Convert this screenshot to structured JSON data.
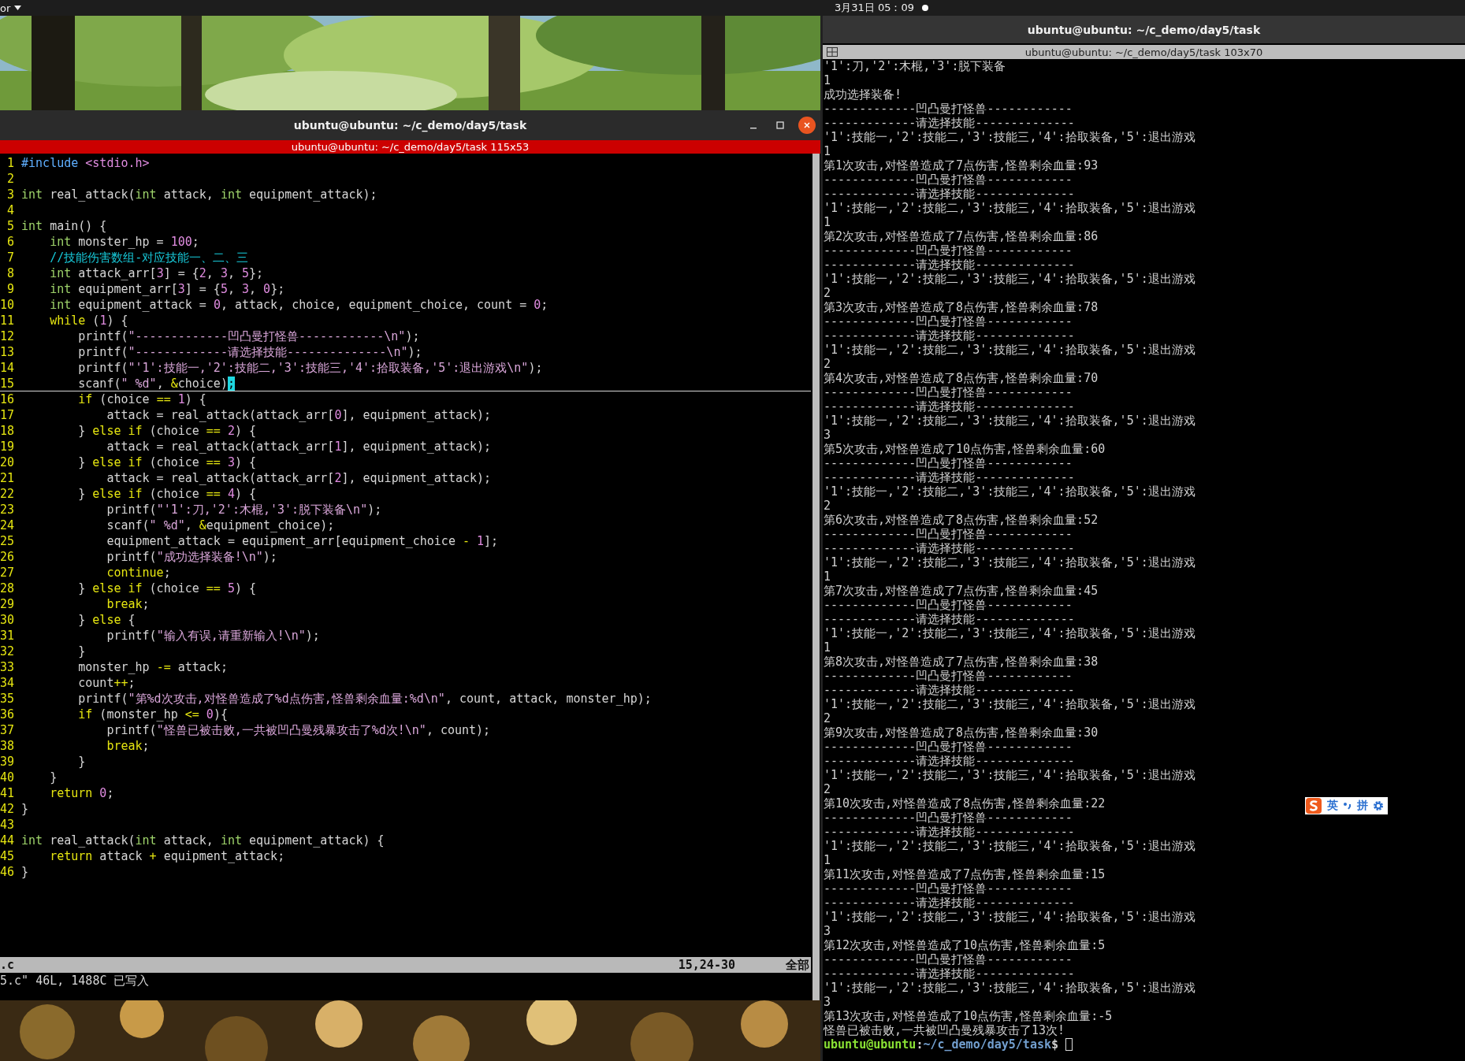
{
  "top_bar": {
    "app_menu": "or",
    "clock": "3月31日 05：09"
  },
  "editor_window": {
    "title": "ubuntu@ubuntu: ~/c_demo/day5/task",
    "tab_title": "ubuntu@ubuntu: ~/c_demo/day5/task 115x53",
    "focused": true,
    "lines": [
      {
        "number": "1",
        "current": false,
        "tokens": [
          {
            "kind": "preproc",
            "text": "#include"
          },
          {
            "kind": "include",
            "text": " <stdio.h>"
          }
        ]
      },
      {
        "number": "2",
        "current": false
      },
      {
        "number": "3",
        "current": false,
        "tokens": [
          {
            "kind": "type",
            "text": "int"
          },
          {
            "kind": "plain",
            "text": " real_attack("
          },
          {
            "kind": "type",
            "text": "int"
          },
          {
            "kind": "plain",
            "text": " attack, "
          },
          {
            "kind": "type",
            "text": "int"
          },
          {
            "kind": "plain",
            "text": " equipment_attack);"
          }
        ]
      },
      {
        "number": "4",
        "current": false
      },
      {
        "number": "5",
        "current": false,
        "tokens": [
          {
            "kind": "type",
            "text": "int"
          },
          {
            "kind": "plain",
            "text": " main() {"
          }
        ]
      },
      {
        "number": "6",
        "current": false,
        "tokens": [
          {
            "kind": "type",
            "text": "    int"
          },
          {
            "kind": "plain",
            "text": " monster_hp = "
          },
          {
            "kind": "number",
            "text": "100"
          },
          {
            "kind": "plain",
            "text": ";"
          }
        ]
      },
      {
        "number": "7",
        "current": false,
        "tokens": [
          {
            "kind": "comment",
            "text": "    //技能伤害数组-对应技能一、二、三"
          }
        ]
      },
      {
        "number": "8",
        "current": false,
        "tokens": [
          {
            "kind": "type",
            "text": "    int"
          },
          {
            "kind": "plain",
            "text": " attack_arr["
          },
          {
            "kind": "number",
            "text": "3"
          },
          {
            "kind": "plain",
            "text": "] = {"
          },
          {
            "kind": "number",
            "text": "2"
          },
          {
            "kind": "plain",
            "text": ", "
          },
          {
            "kind": "number",
            "text": "3"
          },
          {
            "kind": "plain",
            "text": ", "
          },
          {
            "kind": "number",
            "text": "5"
          },
          {
            "kind": "plain",
            "text": "};"
          }
        ]
      },
      {
        "number": "9",
        "current": false,
        "tokens": [
          {
            "kind": "type",
            "text": "    int"
          },
          {
            "kind": "plain",
            "text": " equipment_arr["
          },
          {
            "kind": "number",
            "text": "3"
          },
          {
            "kind": "plain",
            "text": "] = {"
          },
          {
            "kind": "number",
            "text": "5"
          },
          {
            "kind": "plain",
            "text": ", "
          },
          {
            "kind": "number",
            "text": "3"
          },
          {
            "kind": "plain",
            "text": ", "
          },
          {
            "kind": "number",
            "text": "0"
          },
          {
            "kind": "plain",
            "text": "};"
          }
        ]
      },
      {
        "number": "10",
        "current": false,
        "tokens": [
          {
            "kind": "type",
            "text": "    int"
          },
          {
            "kind": "plain",
            "text": " equipment_attack = "
          },
          {
            "kind": "number",
            "text": "0"
          },
          {
            "kind": "plain",
            "text": ", attack, choice, equipment_choice, count = "
          },
          {
            "kind": "number",
            "text": "0"
          },
          {
            "kind": "plain",
            "text": ";"
          }
        ]
      },
      {
        "number": "11",
        "current": false,
        "tokens": [
          {
            "kind": "keyword",
            "text": "    while"
          },
          {
            "kind": "plain",
            "text": " ("
          },
          {
            "kind": "number",
            "text": "1"
          },
          {
            "kind": "plain",
            "text": ") {"
          }
        ]
      },
      {
        "number": "12",
        "current": false,
        "tokens": [
          {
            "kind": "plain",
            "text": "        printf("
          },
          {
            "kind": "string",
            "text": "\"-------------凹凸曼打怪兽------------\\n\""
          },
          {
            "kind": "plain",
            "text": ");"
          }
        ]
      },
      {
        "number": "13",
        "current": false,
        "tokens": [
          {
            "kind": "plain",
            "text": "        printf("
          },
          {
            "kind": "string",
            "text": "\"-------------请选择技能--------------\\n\""
          },
          {
            "kind": "plain",
            "text": ");"
          }
        ]
      },
      {
        "number": "14",
        "current": false,
        "tokens": [
          {
            "kind": "plain",
            "text": "        printf("
          },
          {
            "kind": "string",
            "text": "\"'1':技能一,'2':技能二,'3':技能三,'4':拾取装备,'5':退出游戏\\n\""
          },
          {
            "kind": "plain",
            "text": ");"
          }
        ]
      },
      {
        "number": "15",
        "current": true,
        "tokens": [
          {
            "kind": "plain",
            "text": "        scanf("
          },
          {
            "kind": "string",
            "text": "\" %d\""
          },
          {
            "kind": "plain",
            "text": ", "
          },
          {
            "kind": "operator",
            "text": "&"
          },
          {
            "kind": "plain",
            "text": "choice)"
          },
          {
            "kind": "cursor",
            "text": ";"
          }
        ]
      },
      {
        "number": "16",
        "current": false,
        "tokens": [
          {
            "kind": "keyword",
            "text": "        if"
          },
          {
            "kind": "plain",
            "text": " (choice "
          },
          {
            "kind": "operator",
            "text": "=="
          },
          {
            "kind": "number",
            "text": " 1"
          },
          {
            "kind": "plain",
            "text": ") {"
          }
        ]
      },
      {
        "number": "17",
        "current": false,
        "tokens": [
          {
            "kind": "plain",
            "text": "            attack = real_attack(attack_arr["
          },
          {
            "kind": "number",
            "text": "0"
          },
          {
            "kind": "plain",
            "text": "], equipment_attack);"
          }
        ]
      },
      {
        "number": "18",
        "current": false,
        "tokens": [
          {
            "kind": "plain",
            "text": "        } "
          },
          {
            "kind": "keyword",
            "text": "else if"
          },
          {
            "kind": "plain",
            "text": " (choice "
          },
          {
            "kind": "operator",
            "text": "=="
          },
          {
            "kind": "number",
            "text": " 2"
          },
          {
            "kind": "plain",
            "text": ") {"
          }
        ]
      },
      {
        "number": "19",
        "current": false,
        "tokens": [
          {
            "kind": "plain",
            "text": "            attack = real_attack(attack_arr["
          },
          {
            "kind": "number",
            "text": "1"
          },
          {
            "kind": "plain",
            "text": "], equipment_attack);"
          }
        ]
      },
      {
        "number": "20",
        "current": false,
        "tokens": [
          {
            "kind": "plain",
            "text": "        } "
          },
          {
            "kind": "keyword",
            "text": "else if"
          },
          {
            "kind": "plain",
            "text": " (choice "
          },
          {
            "kind": "operator",
            "text": "=="
          },
          {
            "kind": "number",
            "text": " 3"
          },
          {
            "kind": "plain",
            "text": ") {"
          }
        ]
      },
      {
        "number": "21",
        "current": false,
        "tokens": [
          {
            "kind": "plain",
            "text": "            attack = real_attack(attack_arr["
          },
          {
            "kind": "number",
            "text": "2"
          },
          {
            "kind": "plain",
            "text": "], equipment_attack);"
          }
        ]
      },
      {
        "number": "22",
        "current": false,
        "tokens": [
          {
            "kind": "plain",
            "text": "        } "
          },
          {
            "kind": "keyword",
            "text": "else if"
          },
          {
            "kind": "plain",
            "text": " (choice "
          },
          {
            "kind": "operator",
            "text": "=="
          },
          {
            "kind": "number",
            "text": " 4"
          },
          {
            "kind": "plain",
            "text": ") {"
          }
        ]
      },
      {
        "number": "23",
        "current": false,
        "tokens": [
          {
            "kind": "plain",
            "text": "            printf("
          },
          {
            "kind": "string",
            "text": "\"'1':刀,'2':木棍,'3':脱下装备\\n\""
          },
          {
            "kind": "plain",
            "text": ");"
          }
        ]
      },
      {
        "number": "24",
        "current": false,
        "tokens": [
          {
            "kind": "plain",
            "text": "            scanf("
          },
          {
            "kind": "string",
            "text": "\" %d\""
          },
          {
            "kind": "plain",
            "text": ", "
          },
          {
            "kind": "operator",
            "text": "&"
          },
          {
            "kind": "plain",
            "text": "equipment_choice);"
          }
        ]
      },
      {
        "number": "25",
        "current": false,
        "tokens": [
          {
            "kind": "plain",
            "text": "            equipment_attack = equipment_arr[equipment_choice "
          },
          {
            "kind": "operator",
            "text": "-"
          },
          {
            "kind": "number",
            "text": " 1"
          },
          {
            "kind": "plain",
            "text": "];"
          }
        ]
      },
      {
        "number": "26",
        "current": false,
        "tokens": [
          {
            "kind": "plain",
            "text": "            printf("
          },
          {
            "kind": "string",
            "text": "\"成功选择装备!\\n\""
          },
          {
            "kind": "plain",
            "text": ");"
          }
        ]
      },
      {
        "number": "27",
        "current": false,
        "tokens": [
          {
            "kind": "keyword",
            "text": "            continue"
          },
          {
            "kind": "plain",
            "text": ";"
          }
        ]
      },
      {
        "number": "28",
        "current": false,
        "tokens": [
          {
            "kind": "plain",
            "text": "        } "
          },
          {
            "kind": "keyword",
            "text": "else if"
          },
          {
            "kind": "plain",
            "text": " (choice "
          },
          {
            "kind": "operator",
            "text": "=="
          },
          {
            "kind": "number",
            "text": " 5"
          },
          {
            "kind": "plain",
            "text": ") {"
          }
        ]
      },
      {
        "number": "29",
        "current": false,
        "tokens": [
          {
            "kind": "keyword",
            "text": "            break"
          },
          {
            "kind": "plain",
            "text": ";"
          }
        ]
      },
      {
        "number": "30",
        "current": false,
        "tokens": [
          {
            "kind": "plain",
            "text": "        } "
          },
          {
            "kind": "keyword",
            "text": "else"
          },
          {
            "kind": "plain",
            "text": " {"
          }
        ]
      },
      {
        "number": "31",
        "current": false,
        "tokens": [
          {
            "kind": "plain",
            "text": "            printf("
          },
          {
            "kind": "string",
            "text": "\"输入有误,请重新输入!\\n\""
          },
          {
            "kind": "plain",
            "text": ");"
          }
        ]
      },
      {
        "number": "32",
        "current": false,
        "tokens": [
          {
            "kind": "plain",
            "text": "        }"
          }
        ]
      },
      {
        "number": "33",
        "current": false,
        "tokens": [
          {
            "kind": "plain",
            "text": "        monster_hp "
          },
          {
            "kind": "operator",
            "text": "-="
          },
          {
            "kind": "plain",
            "text": " attack;"
          }
        ]
      },
      {
        "number": "34",
        "current": false,
        "tokens": [
          {
            "kind": "plain",
            "text": "        count"
          },
          {
            "kind": "operator",
            "text": "++"
          },
          {
            "kind": "plain",
            "text": ";"
          }
        ]
      },
      {
        "number": "35",
        "current": false,
        "tokens": [
          {
            "kind": "plain",
            "text": "        printf("
          },
          {
            "kind": "string",
            "text": "\"第%d次攻击,对怪兽造成了%d点伤害,怪兽剩余血量:%d\\n\""
          },
          {
            "kind": "plain",
            "text": ", count, attack, monster_hp);"
          }
        ]
      },
      {
        "number": "36",
        "current": false,
        "tokens": [
          {
            "kind": "keyword",
            "text": "        if"
          },
          {
            "kind": "plain",
            "text": " (monster_hp "
          },
          {
            "kind": "operator",
            "text": "<="
          },
          {
            "kind": "number",
            "text": " 0"
          },
          {
            "kind": "plain",
            "text": "){"
          }
        ]
      },
      {
        "number": "37",
        "current": false,
        "tokens": [
          {
            "kind": "plain",
            "text": "            printf("
          },
          {
            "kind": "string",
            "text": "\"怪兽已被击败,一共被凹凸曼残暴攻击了%d次!\\n\""
          },
          {
            "kind": "plain",
            "text": ", count);"
          }
        ]
      },
      {
        "number": "38",
        "current": false,
        "tokens": [
          {
            "kind": "keyword",
            "text": "            break"
          },
          {
            "kind": "plain",
            "text": ";"
          }
        ]
      },
      {
        "number": "39",
        "current": false,
        "tokens": [
          {
            "kind": "plain",
            "text": "        }"
          }
        ]
      },
      {
        "number": "40",
        "current": false,
        "tokens": [
          {
            "kind": "plain",
            "text": "    }"
          }
        ]
      },
      {
        "number": "41",
        "current": false,
        "tokens": [
          {
            "kind": "keyword",
            "text": "    return"
          },
          {
            "kind": "number",
            "text": " 0"
          },
          {
            "kind": "plain",
            "text": ";"
          }
        ]
      },
      {
        "number": "42",
        "current": false,
        "tokens": [
          {
            "kind": "plain",
            "text": "}"
          }
        ]
      },
      {
        "number": "43",
        "current": false
      },
      {
        "number": "44",
        "current": false,
        "tokens": [
          {
            "kind": "type",
            "text": "int"
          },
          {
            "kind": "plain",
            "text": " real_attack("
          },
          {
            "kind": "type",
            "text": "int"
          },
          {
            "kind": "plain",
            "text": " attack, "
          },
          {
            "kind": "type",
            "text": "int"
          },
          {
            "kind": "plain",
            "text": " equipment_attack) {"
          }
        ]
      },
      {
        "number": "45",
        "current": false,
        "tokens": [
          {
            "kind": "keyword",
            "text": "    return"
          },
          {
            "kind": "plain",
            "text": " attack "
          },
          {
            "kind": "operator",
            "text": "+"
          },
          {
            "kind": "plain",
            "text": " equipment_attack;"
          }
        ]
      },
      {
        "number": "46",
        "current": false,
        "tokens": [
          {
            "kind": "plain",
            "text": "}"
          }
        ]
      }
    ],
    "status_line": {
      "file": ".c",
      "position": "15,24-30",
      "scroll": "全部"
    },
    "message": "5.c\" 46L, 1488C 已写入"
  },
  "terminal_window": {
    "title": "ubuntu@ubuntu: ~/c_demo/day5/task",
    "tab_title": "ubuntu@ubuntu: ~/c_demo/day5/task 103x70",
    "focused": false,
    "lines": [
      "'1':刀,'2':木棍,'3':脱下装备",
      "1",
      "成功选择装备!",
      "-------------凹凸曼打怪兽------------",
      "-------------请选择技能--------------",
      "'1':技能一,'2':技能二,'3':技能三,'4':拾取装备,'5':退出游戏",
      "1",
      "第1次攻击,对怪兽造成了7点伤害,怪兽剩余血量:93",
      "-------------凹凸曼打怪兽------------",
      "-------------请选择技能--------------",
      "'1':技能一,'2':技能二,'3':技能三,'4':拾取装备,'5':退出游戏",
      "1",
      "第2次攻击,对怪兽造成了7点伤害,怪兽剩余血量:86",
      "-------------凹凸曼打怪兽------------",
      "-------------请选择技能--------------",
      "'1':技能一,'2':技能二,'3':技能三,'4':拾取装备,'5':退出游戏",
      "2",
      "第3次攻击,对怪兽造成了8点伤害,怪兽剩余血量:78",
      "-------------凹凸曼打怪兽------------",
      "-------------请选择技能--------------",
      "'1':技能一,'2':技能二,'3':技能三,'4':拾取装备,'5':退出游戏",
      "2",
      "第4次攻击,对怪兽造成了8点伤害,怪兽剩余血量:70",
      "-------------凹凸曼打怪兽------------",
      "-------------请选择技能--------------",
      "'1':技能一,'2':技能二,'3':技能三,'4':拾取装备,'5':退出游戏",
      "3",
      "第5次攻击,对怪兽造成了10点伤害,怪兽剩余血量:60",
      "-------------凹凸曼打怪兽------------",
      "-------------请选择技能--------------",
      "'1':技能一,'2':技能二,'3':技能三,'4':拾取装备,'5':退出游戏",
      "2",
      "第6次攻击,对怪兽造成了8点伤害,怪兽剩余血量:52",
      "-------------凹凸曼打怪兽------------",
      "-------------请选择技能--------------",
      "'1':技能一,'2':技能二,'3':技能三,'4':拾取装备,'5':退出游戏",
      "1",
      "第7次攻击,对怪兽造成了7点伤害,怪兽剩余血量:45",
      "-------------凹凸曼打怪兽------------",
      "-------------请选择技能--------------",
      "'1':技能一,'2':技能二,'3':技能三,'4':拾取装备,'5':退出游戏",
      "1",
      "第8次攻击,对怪兽造成了7点伤害,怪兽剩余血量:38",
      "-------------凹凸曼打怪兽------------",
      "-------------请选择技能--------------",
      "'1':技能一,'2':技能二,'3':技能三,'4':拾取装备,'5':退出游戏",
      "2",
      "第9次攻击,对怪兽造成了8点伤害,怪兽剩余血量:30",
      "-------------凹凸曼打怪兽------------",
      "-------------请选择技能--------------",
      "'1':技能一,'2':技能二,'3':技能三,'4':拾取装备,'5':退出游戏",
      "2",
      "第10次攻击,对怪兽造成了8点伤害,怪兽剩余血量:22",
      "-------------凹凸曼打怪兽------------",
      "-------------请选择技能--------------",
      "'1':技能一,'2':技能二,'3':技能三,'4':拾取装备,'5':退出游戏",
      "1",
      "第11次攻击,对怪兽造成了7点伤害,怪兽剩余血量:15",
      "-------------凹凸曼打怪兽------------",
      "-------------请选择技能--------------",
      "'1':技能一,'2':技能二,'3':技能三,'4':拾取装备,'5':退出游戏",
      "3",
      "第12次攻击,对怪兽造成了10点伤害,怪兽剩余血量:5",
      "-------------凹凸曼打怪兽------------",
      "-------------请选择技能--------------",
      "'1':技能一,'2':技能二,'3':技能三,'4':拾取装备,'5':退出游戏",
      "3",
      "第13次攻击,对怪兽造成了10点伤害,怪兽剩余血量:-5",
      "怪兽已被击败,一共被凹凸曼残暴攻击了13次!"
    ],
    "prompt": {
      "user": "ubuntu@ubuntu",
      "separator": ":",
      "path": "~/c_demo/day5/task",
      "symbol": "$"
    }
  },
  "input_method_bar": {
    "language": "英",
    "mode": "拼"
  }
}
